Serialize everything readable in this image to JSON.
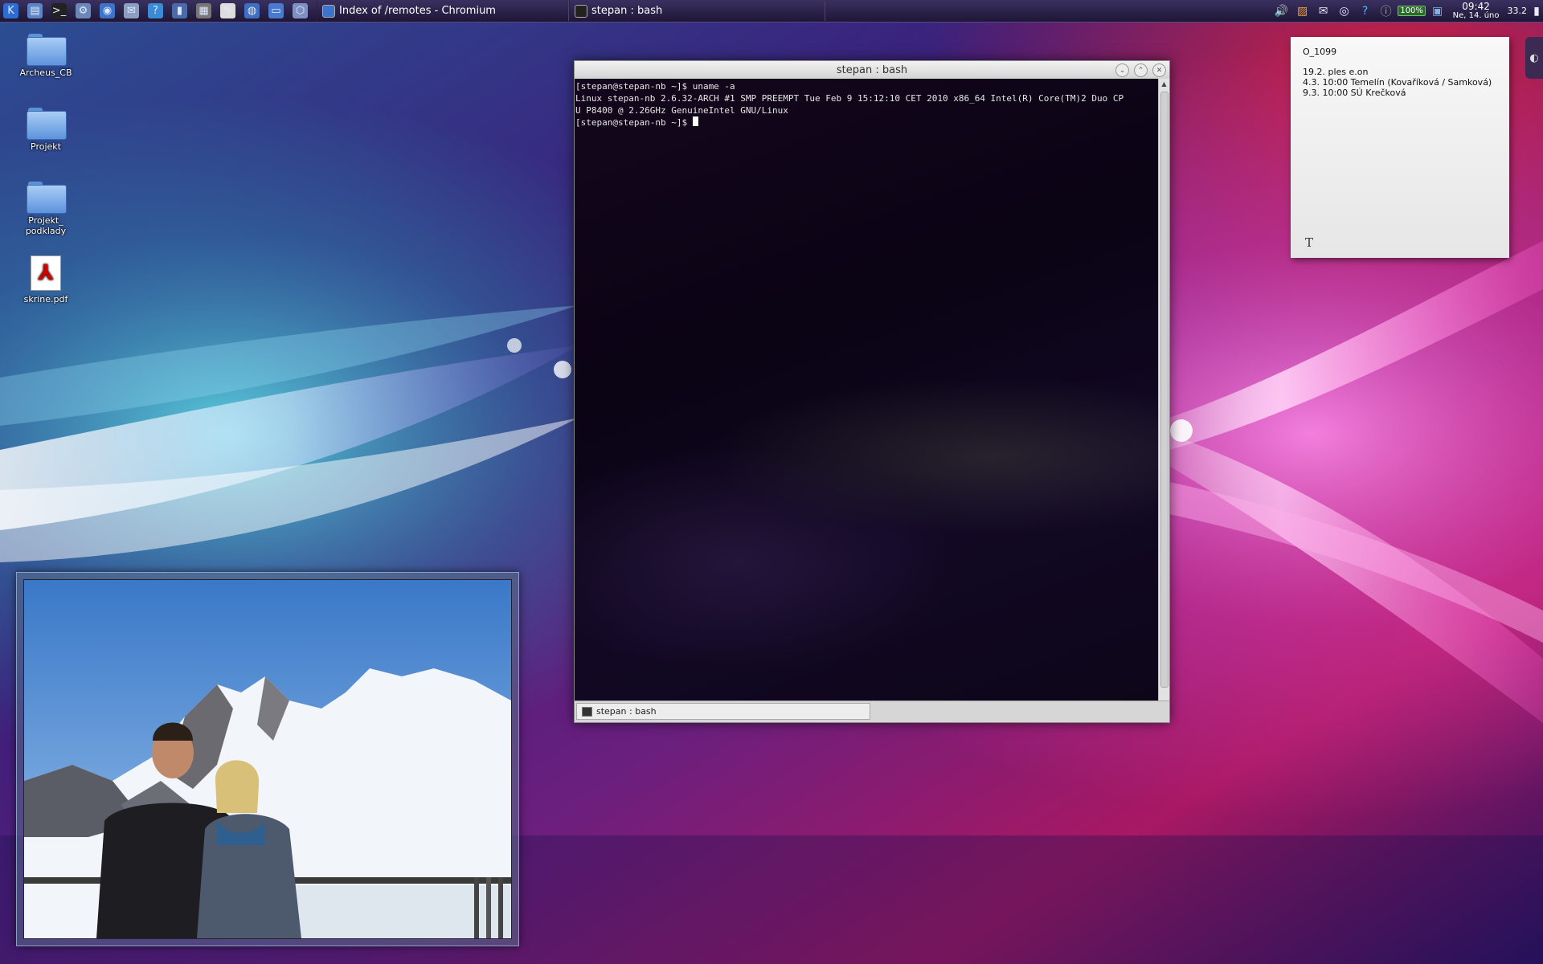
{
  "panel": {
    "launchers": [
      {
        "name": "kde-menu-icon",
        "glyph": "K",
        "color": "#2e6ccf"
      },
      {
        "name": "file-manager-icon",
        "glyph": "▤",
        "color": "#5b84c4"
      },
      {
        "name": "terminal-icon",
        "glyph": ">_",
        "color": "#222222"
      },
      {
        "name": "system-settings-icon",
        "glyph": "⚙",
        "color": "#6b87b8"
      },
      {
        "name": "chromium-icon",
        "glyph": "◉",
        "color": "#3d74c9"
      },
      {
        "name": "mail-icon",
        "glyph": "✉",
        "color": "#8c9fc0"
      },
      {
        "name": "kget-icon",
        "glyph": "?",
        "color": "#3a8ad4"
      },
      {
        "name": "phone-icon",
        "glyph": "▮",
        "color": "#4a6aa8"
      },
      {
        "name": "calculator-icon",
        "glyph": "▦",
        "color": "#777777"
      },
      {
        "name": "text-editor-icon",
        "glyph": "✎",
        "color": "#dddddd"
      },
      {
        "name": "globe-icon",
        "glyph": "◍",
        "color": "#3f6fc0"
      },
      {
        "name": "monitor-icon",
        "glyph": "▭",
        "color": "#4a7ad0"
      },
      {
        "name": "virtualbox-icon",
        "glyph": "⬡",
        "color": "#8090c0"
      }
    ],
    "tasks": [
      {
        "label": "Index of /remotes - Chromium",
        "width": 300
      },
      {
        "label": "stepan : bash",
        "width": 305
      }
    ],
    "tray": {
      "volume_icon": "🔊",
      "rss_icon": "▨",
      "mail_icon": "✉",
      "wifi_icon": "◎",
      "kget_icon": "?",
      "info_icon": "ⓘ",
      "battery": "100%",
      "network_icon": "▣",
      "clock_time": "09:42",
      "clock_date": "Ne, 14. úno",
      "temperature": "33.2"
    }
  },
  "desktop_icons": [
    {
      "label": "Archeus_CB",
      "type": "folder"
    },
    {
      "label": "Projekt",
      "type": "folder"
    },
    {
      "label": "Projekt_\npodklady",
      "type": "folder"
    },
    {
      "label": "skrine.pdf",
      "type": "pdf"
    }
  ],
  "terminal": {
    "title": "stepan : bash",
    "lines": [
      "[stepan@stepan-nb ~]$ uname -a",
      "Linux stepan-nb 2.6.32-ARCH #1 SMP PREEMPT Tue Feb 9 15:12:10 CET 2010 x86_64 Intel(R) Core(TM)2 Duo CP",
      "U P8400 @ 2.26GHz GenuineIntel GNU/Linux",
      "[stepan@stepan-nb ~]$ "
    ],
    "tab_label": "stepan : bash",
    "buttons": {
      "minimize": "⌄",
      "maximize": "⌃",
      "close": "✕"
    }
  },
  "note": {
    "title": "O_1099",
    "lines": [
      "19.2. ples e.on",
      "4.3. 10:00 Temelín (Kovaříková / Samková)",
      "9.3. 10:00 SÚ Krečková"
    ],
    "format_glyph": "T"
  },
  "side_tab": {
    "glyph": "◐"
  }
}
